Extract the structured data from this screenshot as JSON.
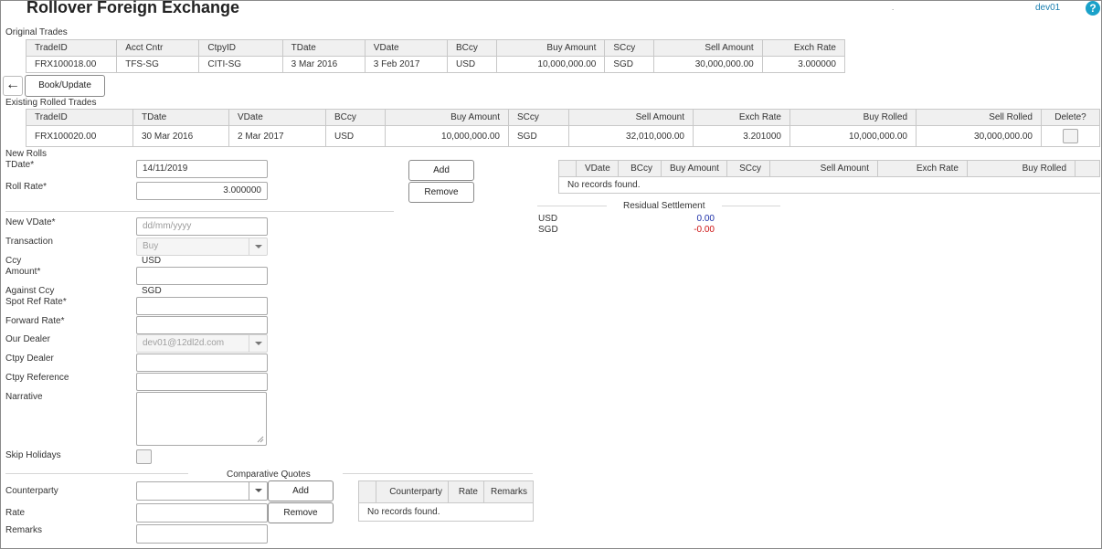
{
  "header": {
    "title": "Rollover Foreign Exchange",
    "dot": ".",
    "user": "dev01",
    "help_icon": "?"
  },
  "original": {
    "label": "Original Trades",
    "columns": [
      "TradeID",
      "Acct Cntr",
      "CtpyID",
      "TDate",
      "VDate",
      "BCcy",
      "Buy Amount",
      "SCcy",
      "Sell Amount",
      "Exch Rate"
    ],
    "rows": [
      [
        "FRX100018.00",
        "TFS-SG",
        "CITI-SG",
        "3 Mar 2016",
        "3 Feb 2017",
        "USD",
        "10,000,000.00",
        "SGD",
        "30,000,000.00",
        "3.000000"
      ]
    ]
  },
  "actions": {
    "back_icon": "←",
    "book_update": "Book/Update"
  },
  "existing": {
    "label": "Existing Rolled Trades",
    "columns": [
      "TradeID",
      "TDate",
      "VDate",
      "BCcy",
      "Buy Amount",
      "SCcy",
      "Sell Amount",
      "Exch Rate",
      "Buy Rolled",
      "Sell Rolled",
      "Delete?"
    ],
    "rows": [
      [
        "FRX100020.00",
        "30 Mar 2016",
        "2 Mar 2017",
        "USD",
        "10,000,000.00",
        "SGD",
        "32,010,000.00",
        "3.201000",
        "10,000,000.00",
        "30,000,000.00"
      ]
    ]
  },
  "new_rolls": {
    "label": "New Rolls",
    "tdate_label": "TDate*",
    "tdate_value": "14/11/2019",
    "rate_label": "Roll Rate*",
    "rate_value": "3.000000",
    "add": "Add",
    "remove": "Remove",
    "columns": [
      "VDate",
      "BCcy",
      "Buy Amount",
      "SCcy",
      "Sell Amount",
      "Exch Rate",
      "Buy Rolled"
    ],
    "empty": "No records found."
  },
  "residual": {
    "label": "Residual Settlement",
    "rows": [
      {
        "ccy": "USD",
        "value": "0.00",
        "color": "#1c2fa8"
      },
      {
        "ccy": "SGD",
        "value": "-0.00",
        "color": "#cc1111"
      }
    ]
  },
  "form": {
    "vdate_label": "New VDate*",
    "vdate_placeholder": "dd/mm/yyyy",
    "transaction_label": "Transaction",
    "transaction_value": "Buy",
    "ccy_label": "Ccy",
    "ccy_value": "USD",
    "amount_label": "Amount*",
    "against_label": "Against Ccy",
    "against_value": "SGD",
    "spot_label": "Spot Ref Rate*",
    "forward_label": "Forward Rate*",
    "dealer_label": "Our Dealer",
    "dealer_value": "dev01@12dl2d.com",
    "ctpy_dealer_label": "Ctpy Dealer",
    "ctpy_ref_label": "Ctpy Reference",
    "narrative_label": "Narrative",
    "skip_label": "Skip Holidays"
  },
  "quotes": {
    "label": "Comparative Quotes",
    "counterparty_label": "Counterparty",
    "rate_label": "Rate",
    "remarks_label": "Remarks",
    "add": "Add",
    "remove": "Remove",
    "columns": [
      "Counterparty",
      "Rate",
      "Remarks"
    ],
    "empty": "No records found."
  }
}
